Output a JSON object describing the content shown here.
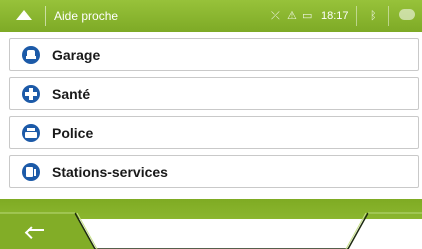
{
  "header": {
    "title": "Aide proche",
    "time": "18:17",
    "icons": [
      "nav-up-icon",
      "route-icon",
      "alert-icon",
      "battery-icon",
      "bluetooth-icon",
      "chat-icon"
    ]
  },
  "list": {
    "items": [
      {
        "label": "Garage",
        "icon": "garage-icon"
      },
      {
        "label": "Santé",
        "icon": "health-cross-icon"
      },
      {
        "label": "Police",
        "icon": "police-icon"
      },
      {
        "label": "Stations-services",
        "icon": "fuel-station-icon"
      }
    ]
  },
  "footer": {
    "back_icon": "back-arrow-icon",
    "up_icon": "up-chevron-icon"
  },
  "colors": {
    "accent_green": "#8bb62f",
    "icon_blue": "#1c5aa8"
  }
}
